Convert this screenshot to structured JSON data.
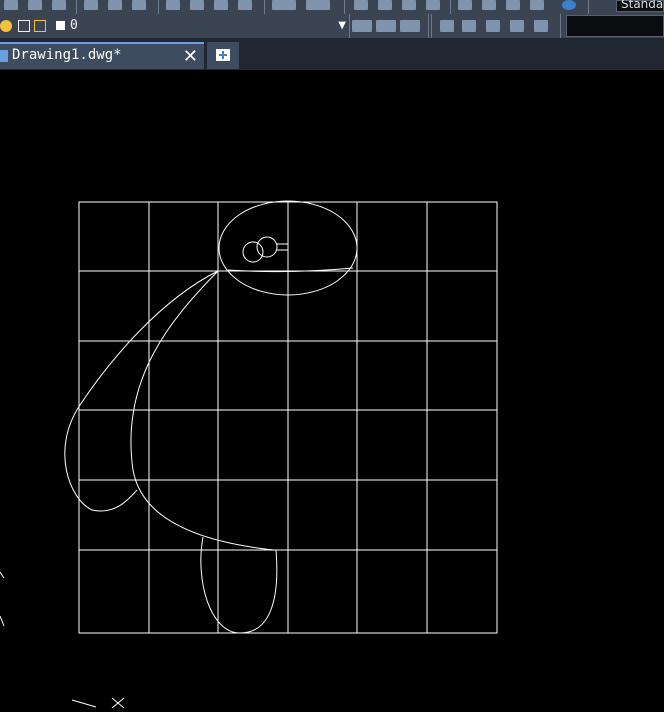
{
  "toolbar": {
    "style_dropdown_text": "Standa"
  },
  "layer_bar": {
    "current_layer": "0"
  },
  "tabs": [
    {
      "label": "Drawing1.dwg*"
    }
  ],
  "icons": {
    "layer": "layer-icon",
    "close": "close-icon",
    "new_tab": "plus-icon"
  },
  "colors": {
    "toolbar_bg": "#3b4453",
    "tab_active": "#3f4b5e",
    "canvas_bg": "#000000",
    "drawing_line": "#ffffff"
  }
}
